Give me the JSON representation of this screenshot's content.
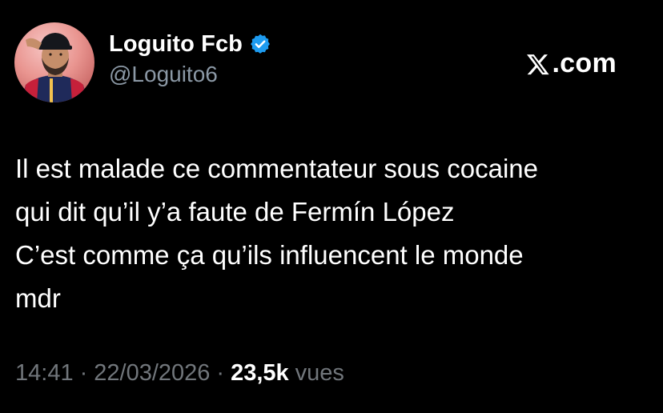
{
  "author": {
    "display_name": "Loguito Fcb",
    "handle": "@Loguito6",
    "verified": true,
    "verified_badge_color": "#1d9bf0"
  },
  "brand": {
    "label": ".com",
    "icon": "x-logo-icon"
  },
  "tweet": {
    "lines": [
      "Il est malade ce commentateur sous cocaine",
      "qui dit qu’il y’a faute de Fermín López",
      "C’est comme ça qu’ils influencent le monde",
      "mdr"
    ]
  },
  "meta": {
    "time": "14:41",
    "separator": "·",
    "date": "22/03/2026",
    "views_count": "23,5k",
    "views_label": "vues"
  },
  "colors": {
    "background": "#000000",
    "text_primary": "#ffffff",
    "text_secondary": "#71767b"
  }
}
